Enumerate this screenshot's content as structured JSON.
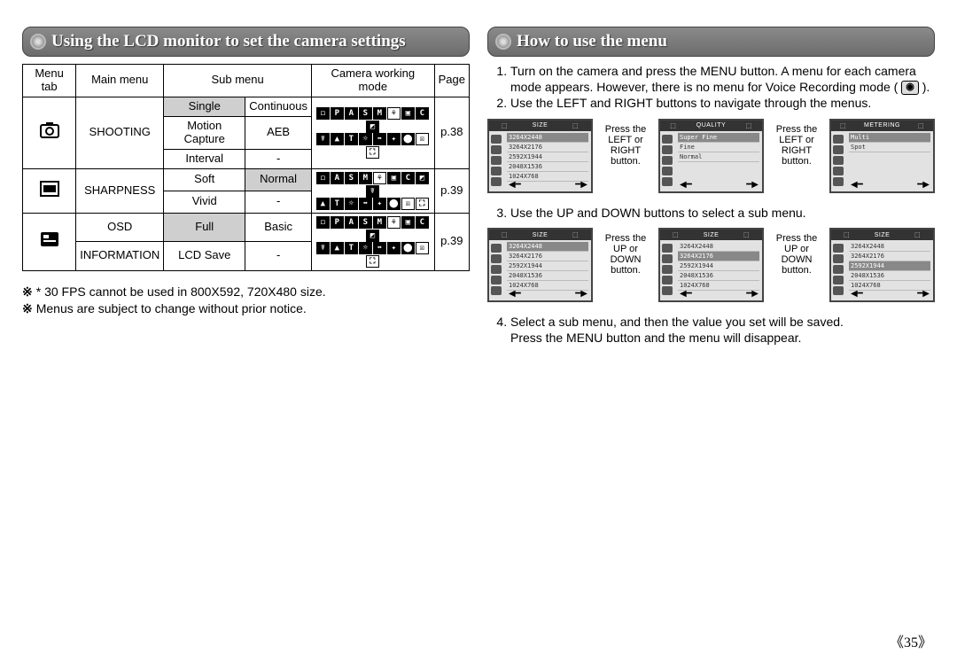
{
  "left_title": "Using the LCD monitor to set the camera settings",
  "right_title": "How to use the menu",
  "table": {
    "headers": {
      "menu_tab": "Menu tab",
      "main_menu": "Main menu",
      "sub_menu": "Sub menu",
      "camera_working_mode": "Camera working mode",
      "page": "Page"
    },
    "shooting": {
      "main": "SHOOTING",
      "sub1a": "Single",
      "sub1b": "Continuous",
      "sub2a": "Motion Capture",
      "sub2b": "AEB",
      "sub3a": "Interval",
      "sub3b": "-",
      "page": "p.38"
    },
    "sharpness": {
      "main": "SHARPNESS",
      "sub1a": "Soft",
      "sub1b": "Normal",
      "sub2a": "Vivid",
      "sub2b": "-",
      "page": "p.39"
    },
    "osd": {
      "main": "OSD\nINFORMATION",
      "main_line1": "OSD",
      "main_line2": "INFORMATION",
      "sub1a": "Full",
      "sub1b": "Basic",
      "sub2a": "LCD Save",
      "sub2b": "-",
      "page": "p.39"
    }
  },
  "notes": {
    "n1": "* 30 FPS cannot be used in 800X592, 720X480 size.",
    "n2": "Menus are subject to change without prior notice."
  },
  "steps": {
    "s1": "Turn on the camera and press the MENU button. A menu for each camera mode appears. However, there is no menu for Voice Recording mode (",
    "s1_end": ").",
    "s2": "Use the LEFT and RIGHT buttons to navigate through the menus.",
    "s3": "Use the UP and DOWN buttons to select a sub menu.",
    "s4a": "Select a sub menu, and then the value you set will be saved.",
    "s4b": "Press the MENU button and the menu will disappear."
  },
  "screens1": {
    "s1": {
      "title": "SIZE",
      "rows": [
        "3264X2448",
        "3264X2176",
        "2592X1944",
        "2048X1536",
        "1024X768"
      ],
      "sel": 0
    },
    "between1": "Press the LEFT or RIGHT button.",
    "s2": {
      "title": "QUALITY",
      "rows": [
        "Super Fine",
        "Fine",
        "Normal"
      ],
      "sel": 0
    },
    "between2": "Press the LEFT or RIGHT button.",
    "s3": {
      "title": "METERING",
      "rows": [
        "Multi",
        "Spot"
      ],
      "sel": 0
    }
  },
  "screens2": {
    "s1": {
      "title": "SIZE",
      "rows": [
        "3264X2448",
        "3264X2176",
        "2592X1944",
        "2048X1536",
        "1024X768"
      ],
      "sel": 0
    },
    "between1": "Press the UP or DOWN button.",
    "s2": {
      "title": "SIZE",
      "rows": [
        "3264X2448",
        "3264X2176",
        "2592X1944",
        "2048X1536",
        "1024X768"
      ],
      "sel": 1
    },
    "between2": "Press the UP or DOWN button.",
    "s3": {
      "title": "SIZE",
      "rows": [
        "3264X2448",
        "3264X2176",
        "2592X1944",
        "2048X1536",
        "1024X768"
      ],
      "sel": 2
    }
  },
  "voice_icon": "◉",
  "page_number": "《35》"
}
